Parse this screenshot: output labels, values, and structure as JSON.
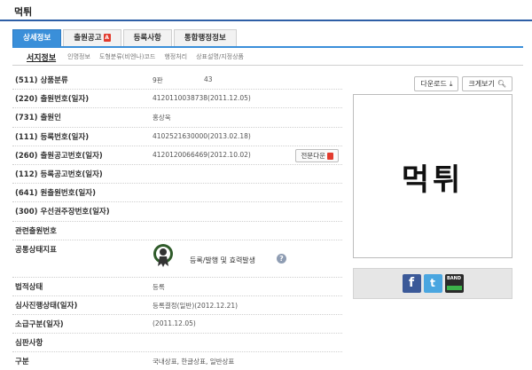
{
  "page": {
    "title": "먹튀"
  },
  "tabs": [
    {
      "label": "상세정보",
      "active": true
    },
    {
      "label": "출원공고",
      "pdf": true
    },
    {
      "label": "등록사항"
    },
    {
      "label": "통합행정정보"
    }
  ],
  "subtabs": [
    {
      "label": "서지정보",
      "active": true
    },
    {
      "label": "인명정보"
    },
    {
      "label": "도형분류(비엔나)코드"
    },
    {
      "label": "행정처리"
    },
    {
      "label": "상표설명/지정상품"
    }
  ],
  "fields": [
    {
      "label": "(511) 상품분류",
      "value": "9판",
      "extra": "43"
    },
    {
      "label": "(220) 출원번호(일자)",
      "value": "4120110038738(2011.12.05)"
    },
    {
      "label": "(731) 출원인",
      "value": "홍상욱"
    },
    {
      "label": "(111) 등록번호(일자)",
      "value": "4102521630000(2013.02.18)"
    },
    {
      "label": "(260) 출원공고번호(일자)",
      "value": "4120120066469(2012.10.02)",
      "button": "전문다운"
    },
    {
      "label": "(112) 등록공고번호(일자)",
      "value": ""
    },
    {
      "label": "(641) 원출원번호(일자)",
      "value": ""
    },
    {
      "label": "(300) 우선권주장번호(일자)",
      "value": ""
    },
    {
      "label": "관련출원번호",
      "value": ""
    }
  ],
  "status_row": {
    "label": "공통상태지표",
    "value": "등록/발행 및 효력발생",
    "icon": "registered-seal-icon"
  },
  "fields2": [
    {
      "label": "법적상태",
      "value": "등록"
    },
    {
      "label": "심사진행상태(일자)",
      "value": "등록결정(일반)(2012.12.21)"
    },
    {
      "label": "소급구분(일자)",
      "value": "(2011.12.05)"
    },
    {
      "label": "심판사항",
      "value": ""
    },
    {
      "label": "구분",
      "value": "국내상표, 한글상표, 일반상표"
    }
  ],
  "right": {
    "download": "다운로드",
    "zoom": "크게보기",
    "mark_text": "먹튀",
    "share": [
      "f",
      "t",
      "BAND"
    ]
  },
  "colors": {
    "accent": "#3a8fd9",
    "header_line": "#2e5fa6",
    "pdf": "#e23b2e"
  }
}
